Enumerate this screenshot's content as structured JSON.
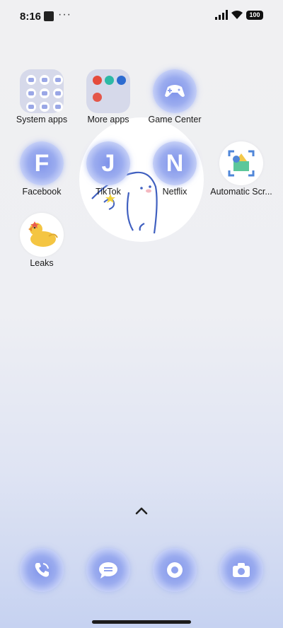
{
  "status": {
    "time": "8:16",
    "dots": "···",
    "battery": "100"
  },
  "apps": [
    {
      "label": "System apps"
    },
    {
      "label": "More apps"
    },
    {
      "label": "Game Center"
    },
    {
      "label": "Facebook",
      "letter": "F"
    },
    {
      "label": "TikTok",
      "letter": "J"
    },
    {
      "label": "Netflix",
      "letter": "N"
    },
    {
      "label": "Automatic Scr..."
    },
    {
      "label": "Leaks"
    }
  ],
  "dock": [
    {
      "icon": "phone-icon"
    },
    {
      "icon": "messages-icon"
    },
    {
      "icon": "browser-icon"
    },
    {
      "icon": "camera-icon"
    }
  ],
  "colors": {
    "accent": "#8fa2ee",
    "glow": "#c7d1f7"
  }
}
